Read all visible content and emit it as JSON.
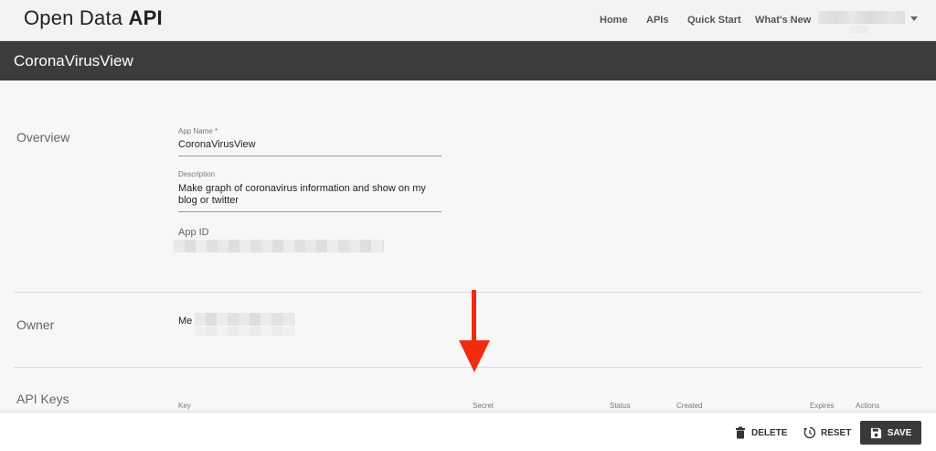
{
  "header": {
    "brand_light": "Open Data ",
    "brand_bold": "API",
    "nav": [
      "Home",
      "APIs",
      "Quick Start",
      "What's New"
    ]
  },
  "page": {
    "title": "CoronaVirusView"
  },
  "overview": {
    "section": "Overview",
    "app_name_label": "App Name *",
    "app_name_value": "CoronaVirusView",
    "description_label": "Description",
    "description_line1": "Make graph of coronavirus information and show on my",
    "description_line2": "blog or twitter",
    "app_id_label": "App ID"
  },
  "owner": {
    "section": "Owner",
    "value": "Me"
  },
  "api_keys": {
    "section": "API Keys",
    "columns": [
      "Key",
      "Secret",
      "Status",
      "Created",
      "Expires",
      "Actions"
    ]
  },
  "footer": {
    "delete": "DELETE",
    "reset": "RESET",
    "save": "SAVE"
  },
  "colors": {
    "title_band": "#3c3c3c",
    "arrow": "#f22a10",
    "save_bg": "#3a3a3a"
  },
  "icons": [
    "trash-icon",
    "reset-icon",
    "floppy-disk-icon",
    "chevron-down-icon",
    "arrow-down-annotation"
  ]
}
